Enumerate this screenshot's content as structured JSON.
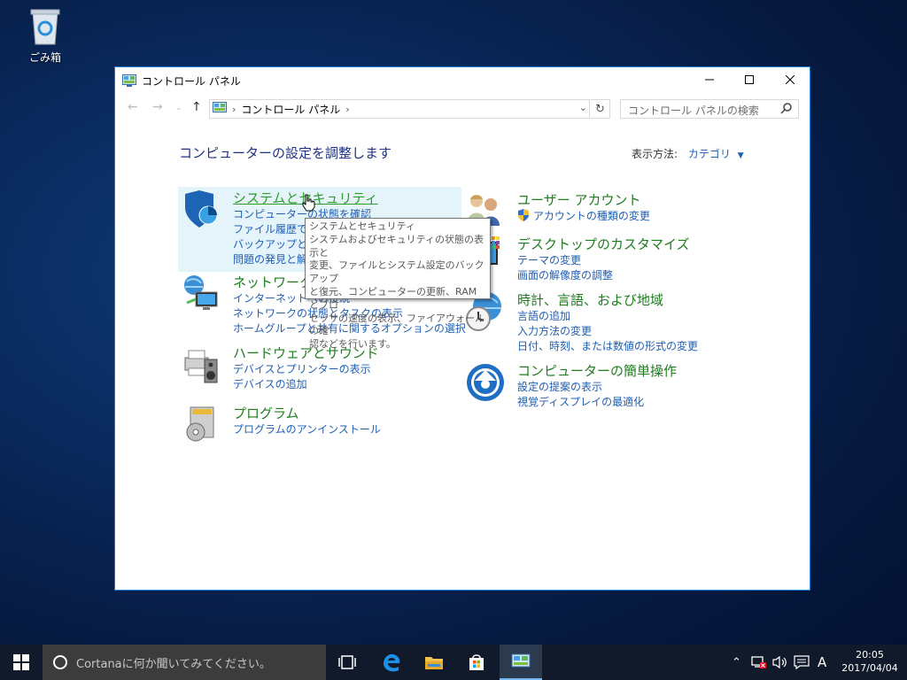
{
  "desktop": {
    "recycle_bin_label": "ごみ箱"
  },
  "window": {
    "title": "コントロール パネル",
    "breadcrumb": [
      "コントロール パネル"
    ],
    "search_placeholder": "コントロール パネルの検索",
    "heading": "コンピューターの設定を調整します",
    "view_by_label": "表示方法:",
    "view_by_value": "カテゴリ",
    "categories_left": [
      {
        "title": "システムとセキュリティ",
        "links": [
          "コンピューターの状態を確認",
          "ファイル履歴でファ",
          "バックアップと復",
          "問題の発見と解"
        ]
      },
      {
        "title": "ネットワークと",
        "links": [
          "インターネットへの接続",
          "ネットワークの状態とタスクの表示",
          "ホームグループと共有に関するオプションの選択"
        ]
      },
      {
        "title": "ハードウェアとサウンド",
        "links": [
          "デバイスとプリンターの表示",
          "デバイスの追加"
        ]
      },
      {
        "title": "プログラム",
        "links": [
          "プログラムのアンインストール"
        ]
      }
    ],
    "categories_right": [
      {
        "title": "ユーザー アカウント",
        "links": [
          "アカウントの種類の変更"
        ]
      },
      {
        "title": "デスクトップのカスタマイズ",
        "links": [
          "テーマの変更",
          "画面の解像度の調整"
        ]
      },
      {
        "title": "時計、言語、および地域",
        "links": [
          "言語の追加",
          "入力方法の変更",
          "日付、時刻、または数値の形式の変更"
        ]
      },
      {
        "title": "コンピューターの簡単操作",
        "links": [
          "設定の提案の表示",
          "視覚ディスプレイの最適化"
        ]
      }
    ],
    "tooltip_lines": [
      "システムとセキュリティ",
      "システムおよびセキュリティの状態の表示と",
      "変更、ファイルとシステム設定のバックアップ",
      "と復元、コンピューターの更新、RAM とプロ",
      "セッサの速度の表示、ファイアウォールの確",
      "認などを行います。"
    ]
  },
  "taskbar": {
    "cortana_placeholder": "Cortanaに何か聞いてみてください。",
    "ime_indicator": "A",
    "time": "20:05",
    "date": "2017/04/04"
  },
  "colors": {
    "accent": "#1b7fd4",
    "link": "#1e5fb4",
    "category_title": "#1e7d1e",
    "heading": "#1e3287"
  }
}
